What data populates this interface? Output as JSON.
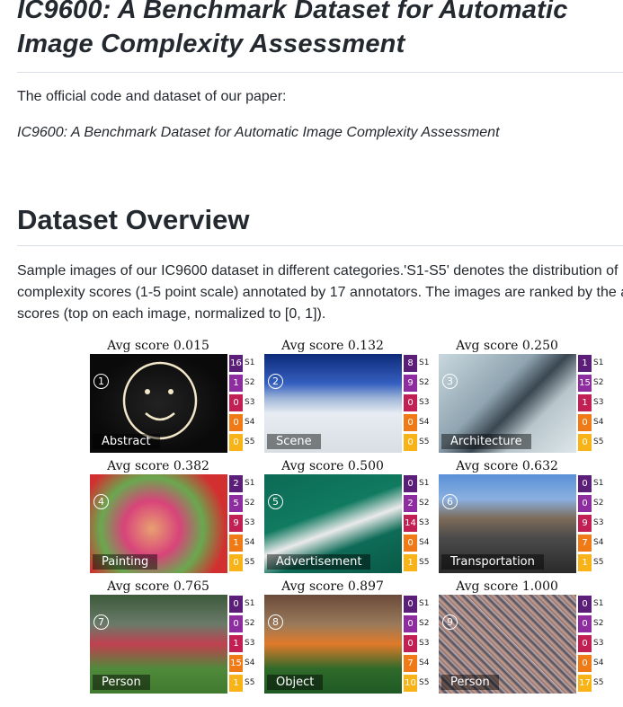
{
  "title_line1": "IC9600: A Benchmark Dataset for Automatic",
  "title_line2": "Image Complexity Assessment",
  "intro": "The official code and dataset of our paper:",
  "paper_title": "IC9600: A Benchmark Dataset for Automatic Image Complexity Assessment",
  "section_heading": "Dataset Overview",
  "desc_line1": "Sample images of our IC9600 dataset in different categories.'S1-S5' denotes the distribution of",
  "desc_line2": "complexity scores (1-5 point scale) annotated by 17 annotators. The images are ranked by the a",
  "desc_line3": "scores (top on each image, normalized to [0, 1]).",
  "score_labels": [
    "S1",
    "S2",
    "S3",
    "S4",
    "S5"
  ],
  "score_colors": [
    "#5b1f7a",
    "#8d2da0",
    "#c21f55",
    "#ef7a16",
    "#f7b318"
  ],
  "tiles": [
    {
      "avg": "Avg score 0.015",
      "num": "1",
      "category": "Abstract",
      "counts": [
        "16",
        "1",
        "0",
        "0",
        "0"
      ],
      "bg": "radial-gradient(ellipse at 50% 50%, #222 0%, #0a0a0a 70%)"
    },
    {
      "avg": "Avg score 0.132",
      "num": "2",
      "category": "Scene",
      "counts": [
        "8",
        "9",
        "0",
        "0",
        "0"
      ],
      "bg": "linear-gradient(#0d2a7a 0%, #3560c0 30%, #9fb6d8 45%, #e6ecf2 60%, #d9dee3 100%)"
    },
    {
      "avg": "Avg score 0.250",
      "num": "3",
      "category": "Architecture",
      "counts": [
        "1",
        "15",
        "1",
        "0",
        "0"
      ],
      "bg": "linear-gradient(135deg, #c9d8de 0%, #8fa4b0 40%, #3a4650 55%, #b8c6cc 70%, #dde6ea 100%)"
    },
    {
      "avg": "Avg score 0.382",
      "num": "4",
      "category": "Painting",
      "counts": [
        "2",
        "5",
        "9",
        "1",
        "0"
      ],
      "bg": "radial-gradient(circle at 45% 55%, #e8a070 0%, #d8447a 30%, #6aa84f 55%, #d23030 80%)"
    },
    {
      "avg": "Avg score 0.500",
      "num": "5",
      "category": "Advertisement",
      "counts": [
        "0",
        "2",
        "14",
        "0",
        "1"
      ],
      "bg": "linear-gradient(160deg, #0c6a55 0%, #107a60 40%, #eaeaea 55%, #0e6b57 70%, #0a5a48 100%)"
    },
    {
      "avg": "Avg score 0.632",
      "num": "6",
      "category": "Transportation",
      "counts": [
        "0",
        "0",
        "9",
        "7",
        "1"
      ],
      "bg": "linear-gradient(#5a90d8 0%, #8ab0e0 25%, #7c6a58 45%, #4a4a4a 65%, #2a2a2a 100%)"
    },
    {
      "avg": "Avg score 0.765",
      "num": "7",
      "category": "Person",
      "counts": [
        "0",
        "0",
        "1",
        "15",
        "1"
      ],
      "bg": "linear-gradient(#3c5a3a 0%, #6a7a6a 30%, #c04050 50%, #4f8a3a 75%, #3f7a2f 100%)"
    },
    {
      "avg": "Avg score 0.897",
      "num": "8",
      "category": "Object",
      "counts": [
        "0",
        "0",
        "0",
        "7",
        "10"
      ],
      "bg": "linear-gradient(#6a4a3a 0%, #9a7a5a 30%, #e07a2a 50%, #2f6a2a 75%, #1f5a25 100%)"
    },
    {
      "avg": "Avg score 1.000",
      "num": "9",
      "category": "Person",
      "counts": [
        "0",
        "0",
        "0",
        "0",
        "17"
      ],
      "bg": "repeating-linear-gradient(45deg, #8a6a6a 0px, #c8a090 3px, #4a4a5a 6px, #d0c0c0 9px)"
    }
  ]
}
